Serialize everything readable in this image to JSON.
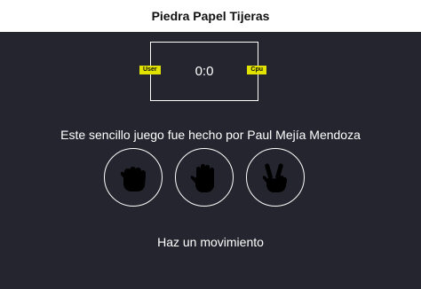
{
  "header": {
    "title": "Piedra Papel Tijeras"
  },
  "scoreboard": {
    "user_label": "User",
    "cpu_label": "Cpu",
    "score": "0:0",
    "badge_color": "#e2e200"
  },
  "credit": "Este sencillo juego fue hecho por Paul Mejía Mendoza",
  "choices": [
    {
      "id": "rock",
      "icon": "rock-fist-icon"
    },
    {
      "id": "paper",
      "icon": "paper-hand-icon"
    },
    {
      "id": "scissors",
      "icon": "scissors-hand-icon"
    }
  ],
  "message": "Haz un movimiento",
  "colors": {
    "background": "#25252f",
    "header_bg": "#ffffff",
    "accent": "#e2e200"
  }
}
